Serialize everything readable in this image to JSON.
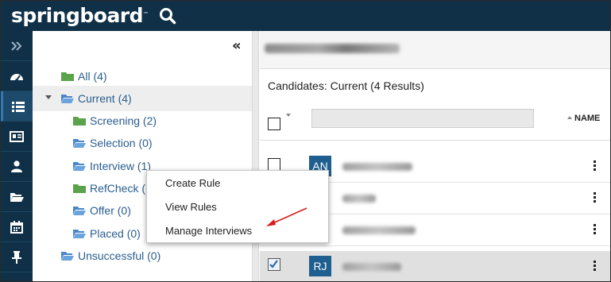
{
  "header": {
    "logo": "springboard",
    "logo_mark": "™",
    "search_icon": "search-icon"
  },
  "rail": {
    "items": [
      {
        "icon": "expand-icon"
      },
      {
        "icon": "dashboard-icon"
      },
      {
        "icon": "list-icon",
        "active": true
      },
      {
        "icon": "id-card-icon"
      },
      {
        "icon": "user-icon"
      },
      {
        "icon": "folder-open-icon"
      },
      {
        "icon": "calendar-icon"
      },
      {
        "icon": "pin-icon"
      }
    ]
  },
  "tree": {
    "collapse_glyph": "«",
    "nodes": [
      {
        "label": "All (4)",
        "folder": "green"
      },
      {
        "label": "Current (4)",
        "folder": "blue",
        "expanded": true,
        "selected": true
      },
      {
        "label": "Screening (2)",
        "folder": "green"
      },
      {
        "label": "Selection (0)",
        "folder": "blue"
      },
      {
        "label": "Interview (1)",
        "folder": "blue"
      },
      {
        "label": "RefCheck (",
        "folder": "green"
      },
      {
        "label": "Offer (0)",
        "folder": "blue"
      },
      {
        "label": "Placed (0)",
        "folder": "blue"
      },
      {
        "label": "Unsuccessful (0)",
        "folder": "blue"
      }
    ]
  },
  "context_menu": {
    "items": [
      "Create Rule",
      "View Rules",
      "Manage Interviews"
    ]
  },
  "main": {
    "results_label": "Candidates: Current (4 Results)",
    "column_name": "NAME",
    "rows": [
      {
        "initials": "AN",
        "checked": false,
        "selected": false
      },
      {
        "initials": "",
        "checked": false,
        "selected": false
      },
      {
        "initials": "",
        "checked": false,
        "selected": false
      },
      {
        "initials": "RJ",
        "checked": true,
        "selected": true
      }
    ]
  },
  "colors": {
    "header_bg": "#0f3047",
    "link_blue": "#2a5d8f",
    "folder_green": "#5aa34a",
    "folder_blue": "#4a86c8",
    "avatar_bg": "#1f5f8f",
    "annotation_arrow": "#d81b1b"
  }
}
